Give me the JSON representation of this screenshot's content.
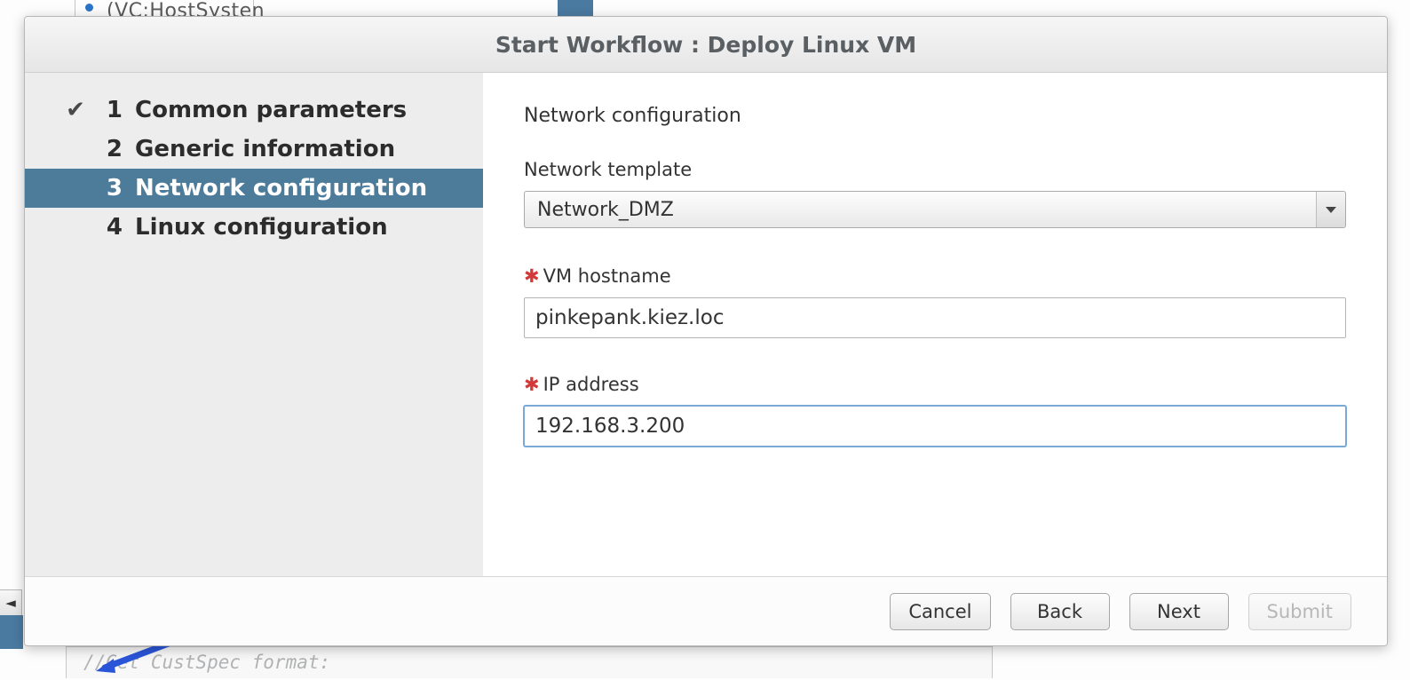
{
  "background": {
    "top_text": "(VC:HostSysten",
    "bottom_text": "//Get      CustSpec format:"
  },
  "dialog": {
    "title": "Start Workflow : Deploy Linux VM",
    "steps": [
      {
        "num": "1",
        "label": "Common parameters",
        "done": true,
        "active": false
      },
      {
        "num": "2",
        "label": "Generic information",
        "done": false,
        "active": false
      },
      {
        "num": "3",
        "label": "Network configuration",
        "done": false,
        "active": true
      },
      {
        "num": "4",
        "label": "Linux configuration",
        "done": false,
        "active": false
      }
    ],
    "content": {
      "section_title": "Network configuration",
      "network_template_label": "Network template",
      "network_template_value": "Network_DMZ",
      "vm_hostname_label": "VM hostname",
      "vm_hostname_value": "pinkepank.kiez.loc",
      "ip_address_label": "IP address",
      "ip_address_value": "192.168.3.200"
    },
    "buttons": {
      "cancel": "Cancel",
      "back": "Back",
      "next": "Next",
      "submit": "Submit"
    }
  }
}
